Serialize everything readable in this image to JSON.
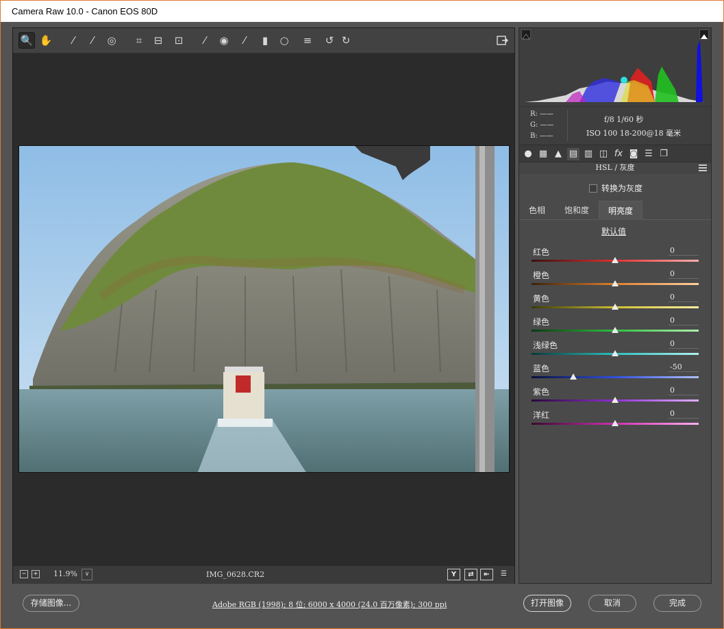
{
  "window": {
    "title": "Camera Raw 10.0 -  Canon EOS 80D"
  },
  "toolbar": {
    "tools": [
      {
        "name": "zoom-tool-icon",
        "glyph": "🔍"
      },
      {
        "name": "hand-tool-icon",
        "glyph": "✋"
      },
      {
        "name": "white-balance-tool-icon",
        "glyph": "⁄"
      },
      {
        "name": "color-sampler-tool-icon",
        "glyph": "⁄"
      },
      {
        "name": "targeted-adjustment-tool-icon",
        "glyph": "◎"
      },
      {
        "name": "crop-tool-icon",
        "glyph": "⌗"
      },
      {
        "name": "straighten-tool-icon",
        "glyph": "⊟"
      },
      {
        "name": "transform-tool-icon",
        "glyph": "⊡"
      },
      {
        "name": "spot-removal-tool-icon",
        "glyph": "⁄"
      },
      {
        "name": "red-eye-removal-icon",
        "glyph": "◉"
      },
      {
        "name": "adjustment-brush-icon",
        "glyph": "⁄"
      },
      {
        "name": "graduated-filter-icon",
        "glyph": "▮"
      },
      {
        "name": "radial-filter-icon",
        "glyph": "○"
      },
      {
        "name": "preferences-icon",
        "glyph": "≡"
      },
      {
        "name": "rotate-left-icon",
        "glyph": "↺"
      },
      {
        "name": "rotate-right-icon",
        "glyph": "↻"
      }
    ]
  },
  "status": {
    "zoom": "11.9%",
    "filename": "IMG_0628.CR2",
    "zoom_out": "−",
    "zoom_in": "+",
    "dd": "∨",
    "compare_y": "Y",
    "swap": "⇄",
    "copy": "⇤",
    "settings": "☰"
  },
  "readout": {
    "r": "R:  ——",
    "g": "G:  ——",
    "b": "B:  ——",
    "exposure": "f/8  1/60 秒",
    "iso_lens": "ISO 100   18-200@18 毫米"
  },
  "panel": {
    "header": "HSL / 灰度",
    "grayscale_label": "转换为灰度",
    "tabs": [
      "色相",
      "饱和度",
      "明亮度"
    ],
    "active_tab": 2,
    "default_link": "默认值",
    "sliders": [
      {
        "label": "红色",
        "value": "0",
        "pos": 0.5,
        "colors": [
          "#3a1010",
          "#e03030",
          "#ffb0b0"
        ]
      },
      {
        "label": "橙色",
        "value": "0",
        "pos": 0.5,
        "colors": [
          "#3a2008",
          "#e08030",
          "#ffd0a0"
        ]
      },
      {
        "label": "黄色",
        "value": "0",
        "pos": 0.5,
        "colors": [
          "#3a3a08",
          "#d0c030",
          "#fff0a0"
        ]
      },
      {
        "label": "绿色",
        "value": "0",
        "pos": 0.5,
        "colors": [
          "#083a10",
          "#30c040",
          "#b0f0b0"
        ]
      },
      {
        "label": "浅绿色",
        "value": "0",
        "pos": 0.5,
        "colors": [
          "#083a3a",
          "#30c0c0",
          "#b0f0f0"
        ]
      },
      {
        "label": "蓝色",
        "value": "-50",
        "pos": 0.25,
        "colors": [
          "#08103a",
          "#3050e0",
          "#b0c0ff"
        ]
      },
      {
        "label": "紫色",
        "value": "0",
        "pos": 0.5,
        "colors": [
          "#28083a",
          "#9030d0",
          "#e0b0ff"
        ]
      },
      {
        "label": "洋红",
        "value": "0",
        "pos": 0.5,
        "colors": [
          "#3a0830",
          "#d030b0",
          "#ffb0f0"
        ]
      }
    ]
  },
  "bottom": {
    "save": "存储图像...",
    "workflow": "Adobe RGB (1998); 8 位; 6000 x 4000 (24.0 百万像素); 300 ppi",
    "open": "打开图像",
    "cancel": "取消",
    "done": "完成"
  }
}
